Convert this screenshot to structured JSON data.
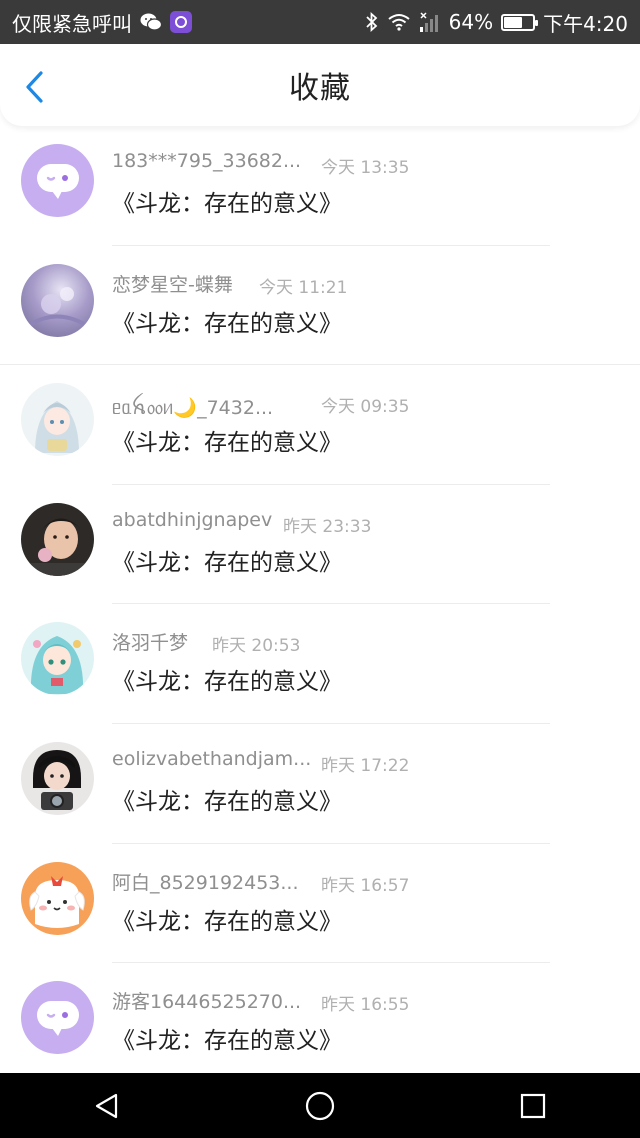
{
  "status_bar": {
    "carrier_text": "仅限紧急呼叫",
    "battery_percent": "64%",
    "battery_level": 0.64,
    "time": "下午4:20",
    "icons": [
      "wechat-icon",
      "app-badge-icon",
      "bluetooth-icon",
      "wifi-icon",
      "signal-icon",
      "battery-icon"
    ]
  },
  "header": {
    "title": "收藏",
    "back_icon": "chevron-left-icon"
  },
  "items": [
    {
      "username": "183***795_33682...",
      "time": "今天 13:35",
      "title": "《斗龙：存在的意义》",
      "avatar": "default-chat-avatar"
    },
    {
      "username": "恋梦星空-蝶舞",
      "time": "今天 11:21",
      "title": "《斗龙：存在的意义》",
      "avatar": "photo-avatar-lavender"
    },
    {
      "username": "ᥱᥲꫝ᥆᥆ᥢ🌙_7432...",
      "time": "今天 09:35",
      "title": "《斗龙：存在的意义》",
      "avatar": "anime-avatar-silver"
    },
    {
      "username": "abatdhinjgnapev",
      "time": "昨天 23:33",
      "title": "《斗龙：存在的意义》",
      "avatar": "photo-avatar-girl"
    },
    {
      "username": "洛羽千梦",
      "time": "昨天 20:53",
      "title": "《斗龙：存在的意义》",
      "avatar": "anime-avatar-teal"
    },
    {
      "username": "eolizvabethandjam...",
      "time": "昨天 17:22",
      "title": "《斗龙：存在的意义》",
      "avatar": "photo-avatar-camera"
    },
    {
      "username": "阿白_8529192453...",
      "time": "昨天 16:57",
      "title": "《斗龙：存在的意义》",
      "avatar": "cartoon-dog-avatar"
    },
    {
      "username": "游客16446525270...",
      "time": "昨天 16:55",
      "title": "《斗龙：存在的意义》",
      "avatar": "default-chat-avatar"
    }
  ],
  "nav": {
    "icons": [
      "back-triangle-icon",
      "home-circle-icon",
      "recents-square-icon"
    ]
  },
  "colors": {
    "status_bg": "#3a3a3a",
    "accent_blue": "#1e88e5",
    "default_avatar": "#c7aef0",
    "text_primary": "#222222",
    "text_secondary": "#8f8f8f",
    "text_time": "#b0b0b0"
  }
}
